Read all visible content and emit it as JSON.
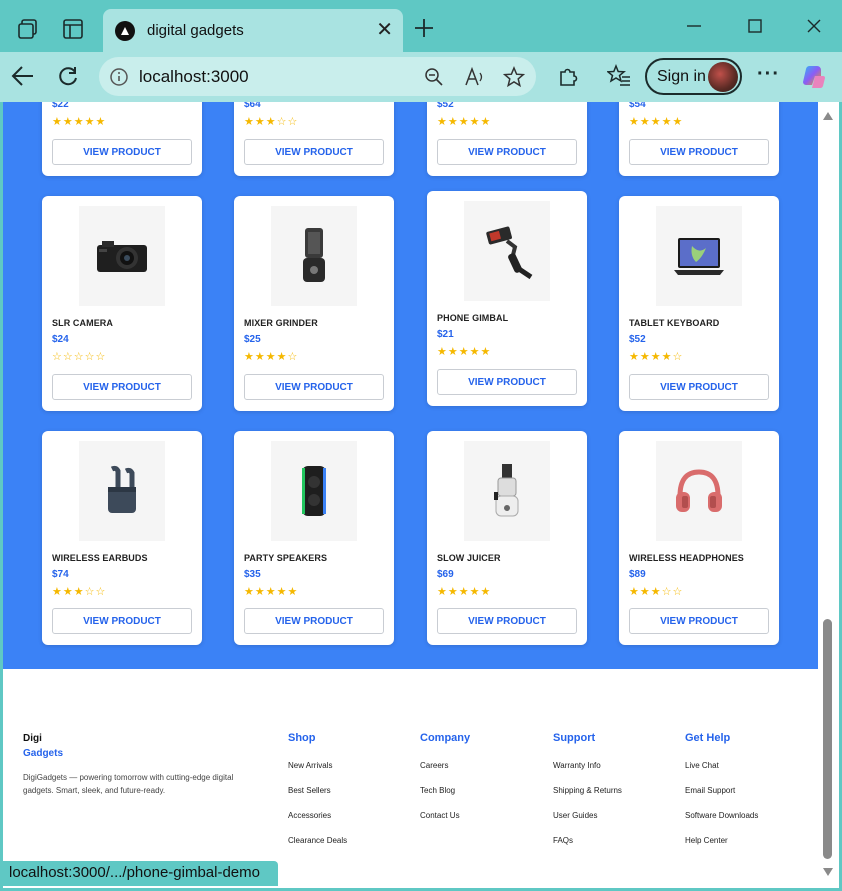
{
  "browser": {
    "tab_title": "digital gadgets",
    "address": "localhost:3000",
    "signin_label": "Sign in",
    "status_url": "localhost:3000/.../phone-gimbal-demo"
  },
  "top_row": [
    {
      "price": "$22",
      "rating": 5,
      "button": "VIEW PRODUCT"
    },
    {
      "price": "$64",
      "rating": 3,
      "button": "VIEW PRODUCT"
    },
    {
      "price": "$52",
      "rating": 5,
      "button": "VIEW PRODUCT"
    },
    {
      "price": "$54",
      "rating": 5,
      "button": "VIEW PRODUCT"
    }
  ],
  "products": [
    {
      "name": "SLR CAMERA",
      "price": "$24",
      "rating": 0,
      "icon": "camera-icon",
      "button": "VIEW PRODUCT"
    },
    {
      "name": "MIXER GRINDER",
      "price": "$25",
      "rating": 4,
      "icon": "mixer-icon",
      "button": "VIEW PRODUCT"
    },
    {
      "name": "PHONE GIMBAL",
      "price": "$21",
      "rating": 5,
      "icon": "gimbal-icon",
      "button": "VIEW PRODUCT"
    },
    {
      "name": "TABLET KEYBOARD",
      "price": "$52",
      "rating": 4,
      "icon": "tablet-icon",
      "button": "VIEW PRODUCT"
    },
    {
      "name": "WIRELESS EARBUDS",
      "price": "$74",
      "rating": 3,
      "icon": "earbuds-icon",
      "button": "VIEW PRODUCT"
    },
    {
      "name": "PARTY SPEAKERS",
      "price": "$35",
      "rating": 5,
      "icon": "speaker-icon",
      "button": "VIEW PRODUCT"
    },
    {
      "name": "SLOW JUICER",
      "price": "$69",
      "rating": 5,
      "icon": "juicer-icon",
      "button": "VIEW PRODUCT"
    },
    {
      "name": "WIRELESS HEADPHONES",
      "price": "$89",
      "rating": 3,
      "icon": "headphones-icon",
      "button": "VIEW PRODUCT"
    }
  ],
  "footer": {
    "brand_line1": "Digi",
    "brand_line2": "Gadgets",
    "description": "DigiGadgets — powering tomorrow with cutting-edge digital gadgets. Smart, sleek, and future-ready.",
    "columns": [
      {
        "title": "Shop",
        "links": [
          "New Arrivals",
          "Best Sellers",
          "Accessories",
          "Clearance Deals"
        ]
      },
      {
        "title": "Company",
        "links": [
          "Careers",
          "Tech Blog",
          "Contact Us"
        ]
      },
      {
        "title": "Support",
        "links": [
          "Warranty Info",
          "Shipping & Returns",
          "User Guides",
          "FAQs"
        ]
      },
      {
        "title": "Get Help",
        "links": [
          "Live Chat",
          "Email Support",
          "Software Downloads",
          "Help Center"
        ]
      }
    ]
  },
  "colors": {
    "accent": "#2563eb",
    "banner": "#3b82f6",
    "star": "#f5b800"
  }
}
